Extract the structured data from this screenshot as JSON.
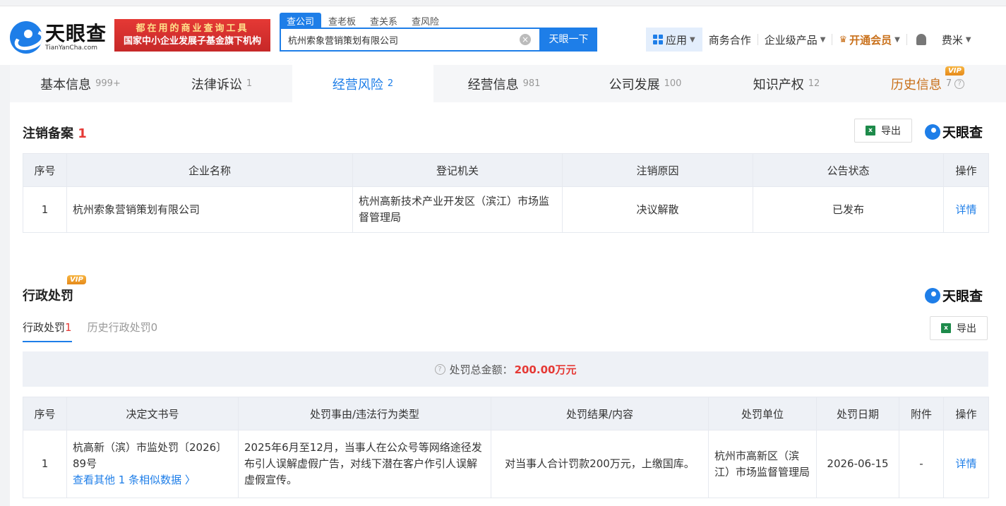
{
  "header": {
    "logo_cn": "天眼查",
    "logo_en": "TianYanCha.com",
    "banner_line1": "都在用的商业查询工具",
    "banner_line2": "国家中小企业发展子基金旗下机构",
    "search_tabs": [
      "查公司",
      "查老板",
      "查关系",
      "查风险"
    ],
    "search_value": "杭州索象营销策划有限公司",
    "search_button": "天眼一下",
    "nav": {
      "apps": "应用",
      "business": "商务合作",
      "enterprise": "企业级产品",
      "vip": "开通会员",
      "user": "费米"
    }
  },
  "tabs": [
    {
      "label": "基本信息",
      "count": "999+"
    },
    {
      "label": "法律诉讼",
      "count": "1"
    },
    {
      "label": "经营风险",
      "count": "2"
    },
    {
      "label": "经营信息",
      "count": "981"
    },
    {
      "label": "公司发展",
      "count": "100"
    },
    {
      "label": "知识产权",
      "count": "12"
    },
    {
      "label": "历史信息",
      "count": "7"
    }
  ],
  "vip_label": "VIP",
  "cancellation": {
    "title": "注销备案",
    "count": "1",
    "export": "导出",
    "brand": "天眼查",
    "columns": [
      "序号",
      "企业名称",
      "登记机关",
      "注销原因",
      "公告状态",
      "操作"
    ],
    "rows": [
      {
        "no": "1",
        "company": "杭州索象营销策划有限公司",
        "authority": "杭州高新技术产业开发区（滨江）市场监督管理局",
        "reason": "决议解散",
        "status": "已发布",
        "action": "详情"
      }
    ]
  },
  "penalty": {
    "title": "行政处罚",
    "brand": "天眼查",
    "sub_tabs": [
      {
        "label": "行政处罚",
        "count": "1"
      },
      {
        "label": "历史行政处罚",
        "count": "0"
      }
    ],
    "export": "导出",
    "summary_label": "处罚总金额：",
    "summary_amount": "200.00万元",
    "columns": [
      "序号",
      "决定文书号",
      "处罚事由/违法行为类型",
      "处罚结果/内容",
      "处罚单位",
      "处罚日期",
      "附件",
      "操作"
    ],
    "rows": [
      {
        "no": "1",
        "doc_no": "杭高新（滨）市监处罚〔2026〕89号",
        "more": "查看其他 1 条相似数据 〉",
        "reason": "2025年6月至12月，当事人在公众号等网络途径发布引人误解虚假广告，对线下潜在客户作引人误解虚假宣传。",
        "result": "对当事人合计罚款200万元，上缴国库。",
        "unit": "杭州市高新区（滨江）市场监督管理局",
        "date": "2026-06-15",
        "attachment": "-",
        "action": "详情"
      }
    ]
  },
  "colors": {
    "accent": "#1e7ee8",
    "red": "#e53935",
    "vip": "#c9701a"
  }
}
